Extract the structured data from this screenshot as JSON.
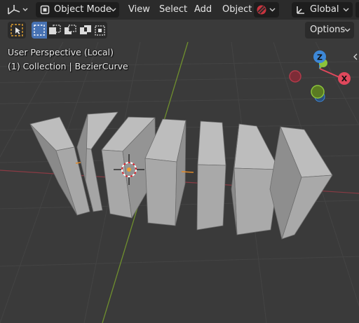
{
  "header": {
    "mode_label": "Object Mode",
    "menus": [
      "View",
      "Select",
      "Add",
      "Object"
    ],
    "orientation_label": "Global"
  },
  "toolbar": {
    "options_label": "Options"
  },
  "viewport": {
    "perspective_label": "User Perspective (Local)",
    "collection_label": "(1) Collection | BezierCurve"
  },
  "gizmo": {
    "z_label": "Z",
    "x_label": "X"
  },
  "colors": {
    "x_axis": "#e0485c",
    "y_axis": "#8cc43a",
    "z_axis": "#3d88d8",
    "grid_bg": "#3a3a3a",
    "header_bg": "#2b2b2b",
    "selected_outline": "#e8a33a"
  }
}
